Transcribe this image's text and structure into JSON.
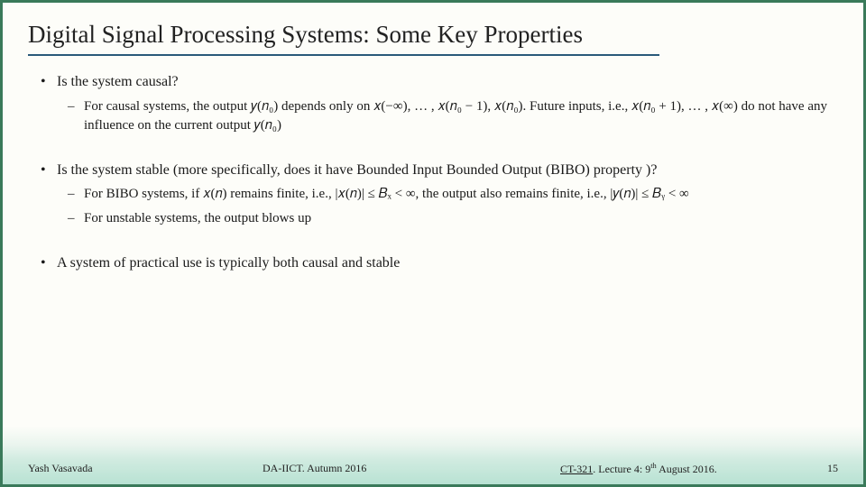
{
  "title": "Digital Signal Processing Systems: Some Key Properties",
  "bullets": {
    "b1": "Is the system causal?",
    "b1_sub1": "For causal systems, the output 𝑦(𝑛₀) depends only on 𝑥(−∞), … , 𝑥(𝑛₀ − 1), 𝑥(𝑛₀). Future inputs, i.e., 𝑥(𝑛₀ + 1), … , 𝑥(∞) do not have any influence on the current output 𝑦(𝑛₀)",
    "b2": "Is the system stable (more specifically, does it have Bounded Input Bounded Output (BIBO) property )?",
    "b2_sub1": "For BIBO systems, if 𝑥(𝑛) remains finite, i.e., |𝑥(𝑛)| ≤ 𝐵ₓ < ∞, the output also remains finite, i.e., |𝑦(𝑛)| ≤ 𝐵ᵧ < ∞",
    "b2_sub2": "For unstable systems, the output blows up",
    "b3": "A system of practical use is typically both causal and stable"
  },
  "footer": {
    "author": "Yash Vasavada",
    "inst": "DA-IICT.  Autumn 2016",
    "course": "CT-321",
    "lecture_prefix": ".  Lecture 4:  9",
    "lecture_sup": "th",
    "lecture_suffix": " August 2016.",
    "page": "15"
  }
}
